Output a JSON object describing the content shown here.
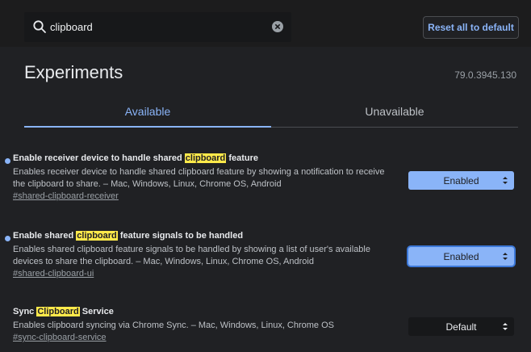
{
  "search": {
    "value": "clipboard"
  },
  "reset_button": {
    "label": "Reset all to default"
  },
  "header": {
    "title": "Experiments",
    "version": "79.0.3945.130"
  },
  "tabs": [
    {
      "label": "Available",
      "active": true
    },
    {
      "label": "Unavailable",
      "active": false
    }
  ],
  "experiments": [
    {
      "title_before": "Enable receiver device to handle shared ",
      "title_highlight": "clipboard",
      "title_after": " feature",
      "description": "Enables receiver device to handle shared clipboard feature by showing a notification to receive the clipboard to share. – Mac, Windows, Linux, Chrome OS, Android",
      "link": "#shared-clipboard-receiver",
      "state": "Enabled",
      "modified": true
    },
    {
      "title_before": "Enable shared ",
      "title_highlight": "clipboard",
      "title_after": " feature signals to be handled",
      "description": "Enables shared clipboard feature signals to be handled by showing a list of user's available devices to share the clipboard. – Mac, Windows, Linux, Chrome OS, Android",
      "link": "#shared-clipboard-ui",
      "state": "Enabled",
      "modified": true
    },
    {
      "title_before": "Sync ",
      "title_highlight": "Clipboard",
      "title_after": " Service",
      "description": "Enables clipboard syncing via Chrome Sync. – Mac, Windows, Linux, Chrome OS",
      "link": "#sync-clipboard-service",
      "state": "Default",
      "modified": false
    }
  ],
  "colors": {
    "background": "#202124",
    "accent": "#8ab4f8",
    "highlight": "#ffe94a"
  }
}
